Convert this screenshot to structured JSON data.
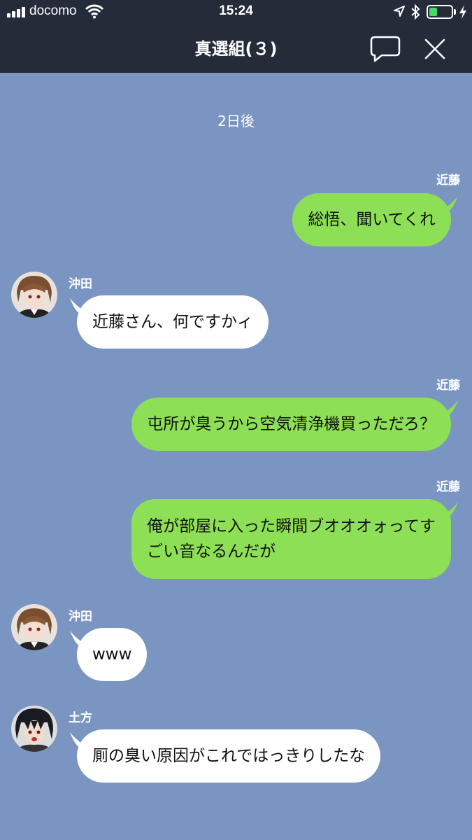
{
  "status_bar": {
    "carrier": "docomo",
    "time": "15:24",
    "battery_level": 0.35
  },
  "header": {
    "title": "真選組(３)"
  },
  "date_divider": "2日後",
  "messages": [
    {
      "sender": "近藤",
      "text": "総悟、聞いてくれ"
    },
    {
      "sender": "沖田",
      "text": "近藤さん、何ですかィ"
    },
    {
      "sender": "近藤",
      "text": "屯所が臭うから空気清浄機買っただろ？"
    },
    {
      "sender": "近藤",
      "lines": [
        "俺が部屋に入った瞬間ブオオオォってす",
        "ごい音なるんだが"
      ]
    },
    {
      "sender": "沖田",
      "text": "www"
    },
    {
      "sender": "土方",
      "text": "厠の臭い原因がこれではっきりしたな"
    }
  ],
  "colors": {
    "background": "#7b95c2",
    "header": "#242c3a",
    "my_bubble": "#8de055",
    "their_bubble": "#ffffff"
  },
  "icons": [
    "signal-icon",
    "wifi-icon",
    "location-icon",
    "bluetooth-icon",
    "battery-icon",
    "charging-icon",
    "chat-icon",
    "close-icon"
  ]
}
